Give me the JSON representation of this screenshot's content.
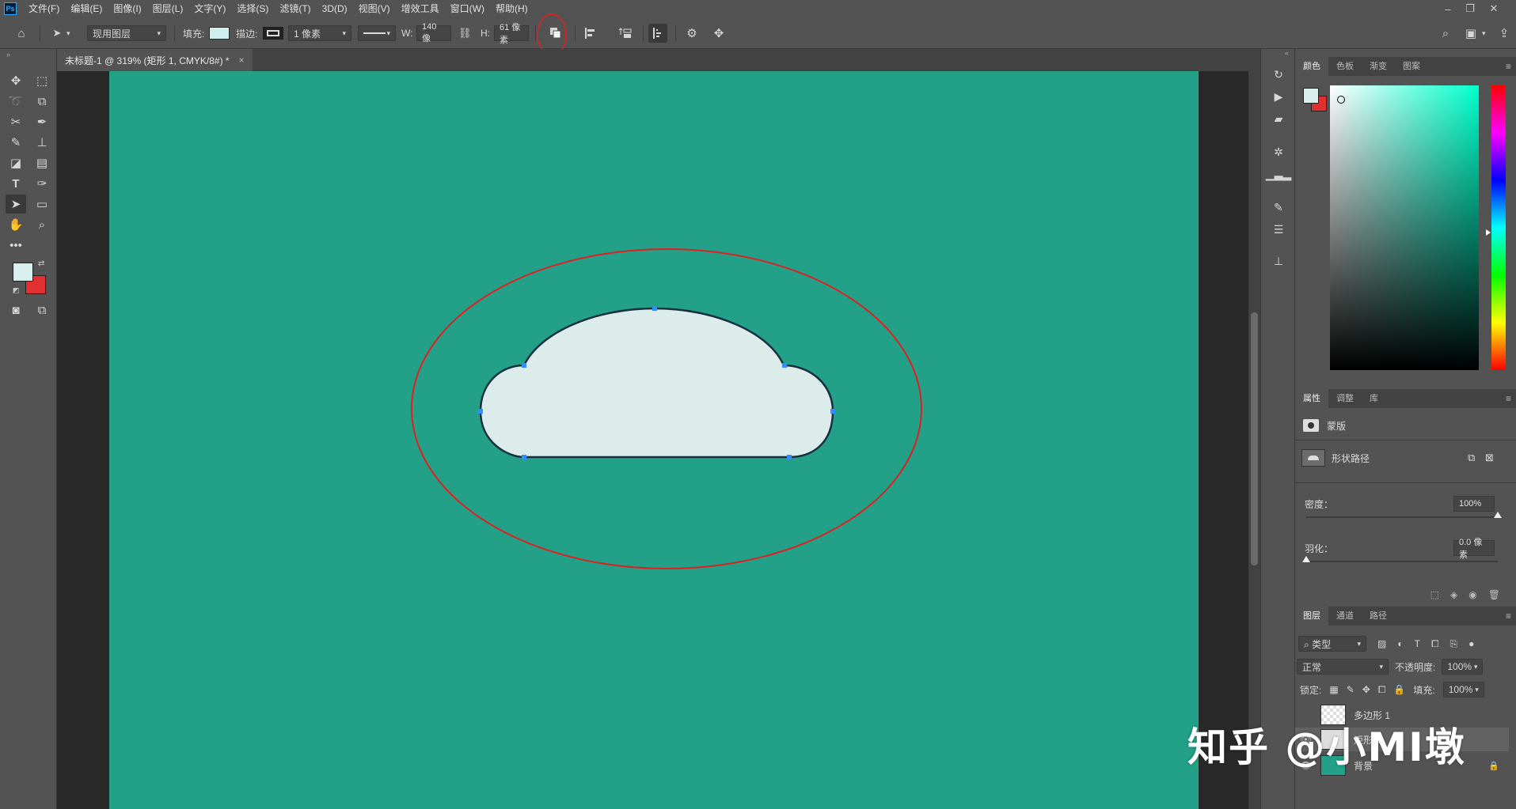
{
  "app": {
    "logo": "Ps",
    "menu": [
      "文件(F)",
      "编辑(E)",
      "图像(I)",
      "图层(L)",
      "文字(Y)",
      "选择(S)",
      "滤镜(T)",
      "3D(D)",
      "视图(V)",
      "增效工具",
      "窗口(W)",
      "帮助(H)"
    ]
  },
  "options": {
    "layer_select": "现用图层",
    "fill_label": "填充:",
    "fill_color": "#cfeeed",
    "stroke_label": "描边:",
    "stroke_size": "1 像素",
    "width_label": "W:",
    "width_value": "140 像",
    "height_label": "H:",
    "height_value": "61 像素",
    "highlight_color": "#e02020"
  },
  "document": {
    "tab_title": "未标题-1 @ 319% (矩形 1, CMYK/8#) *",
    "canvas_color": "#22a088",
    "shape_fill": "#dcecea"
  },
  "toolbox": {
    "foreground_color": "#d8f0ee",
    "background_color": "#e03030"
  },
  "color_panel": {
    "tabs": [
      "颜色",
      "色板",
      "渐变",
      "图案"
    ]
  },
  "properties_panel": {
    "tabs": [
      "属性",
      "调整",
      "库"
    ],
    "mask_label": "蒙版",
    "path_label": "形状路径",
    "density_label": "密度：",
    "density_value": "100%",
    "density": 1.0,
    "feather_label": "羽化：",
    "feather_value": "0.0 像素",
    "feather": 0.0
  },
  "layers_panel": {
    "tabs": [
      "图层",
      "通道",
      "路径"
    ],
    "filter_label": "类型",
    "blend_mode": "正常",
    "opacity_label": "不透明度:",
    "opacity_value": "100%",
    "lock_label": "锁定:",
    "fill_label": "填充:",
    "fill_value": "100%",
    "layers": [
      {
        "name": "多边形 1",
        "visible": false
      },
      {
        "name": "矩形 1",
        "visible": true
      },
      {
        "name": "背景",
        "visible": true
      }
    ]
  },
  "watermark": "知乎 @小MI墩"
}
